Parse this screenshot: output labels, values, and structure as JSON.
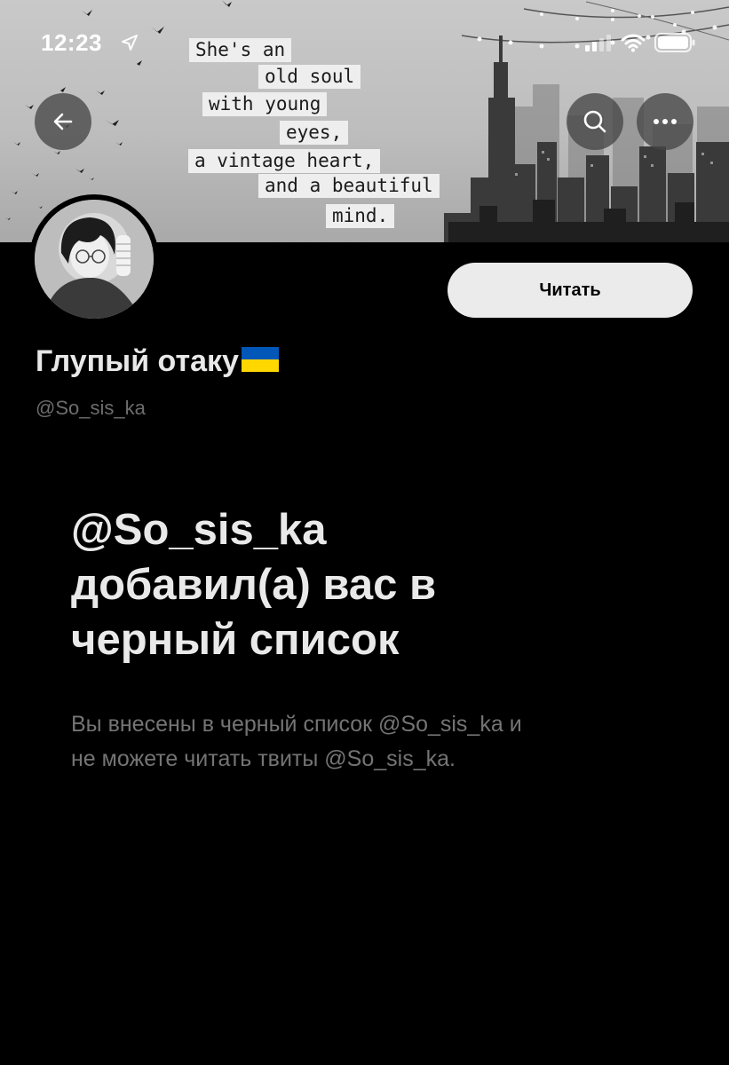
{
  "status_bar": {
    "time": "12:23"
  },
  "banner": {
    "quote_lines": [
      "She's an",
      "old soul",
      "with young",
      "eyes,",
      "a vintage heart,",
      "and a beautiful",
      "mind."
    ]
  },
  "header": {
    "back_icon": "arrow-left-icon",
    "search_icon": "search-icon",
    "more_icon": "more-horizontal-icon"
  },
  "profile": {
    "display_name": "Глупый отаку",
    "handle": "@So_sis_ka",
    "follow_label": "Читать",
    "flag_colors": [
      "#0057B7",
      "#FFD700"
    ]
  },
  "blocked": {
    "title_line1": "@So_sis_ka",
    "title_line2": "добавил(а) вас в",
    "title_line3": "черный список",
    "desc_line1": "Вы внесены в черный список @So_sis_ka и",
    "desc_line2": "не можете читать твиты @So_sis_ka."
  },
  "colors": {
    "background": "#000000",
    "follow_button_bg": "#EBEBEB",
    "secondary_text": "#747474"
  }
}
